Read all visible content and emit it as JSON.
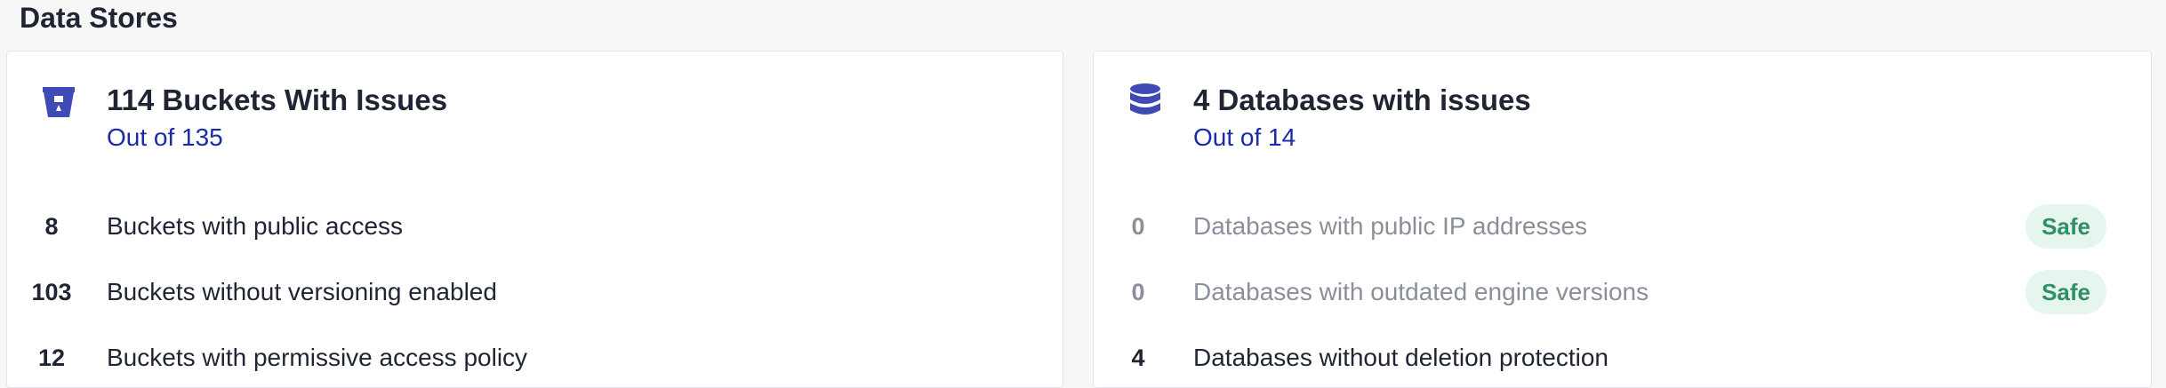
{
  "section": {
    "title": "Data Stores"
  },
  "buckets_card": {
    "icon": "bucket-icon",
    "title": "114 Buckets With Issues",
    "subtitle": "Out of 135",
    "rows": [
      {
        "count": "8",
        "label": "Buckets with public access"
      },
      {
        "count": "103",
        "label": "Buckets without versioning enabled"
      },
      {
        "count": "12",
        "label": "Buckets with permissive access policy"
      }
    ]
  },
  "databases_card": {
    "icon": "database-icon",
    "title": "4 Databases with issues",
    "subtitle": "Out of 14",
    "rows": [
      {
        "count": "0",
        "label": "Databases with public IP addresses",
        "badge": "Safe"
      },
      {
        "count": "0",
        "label": "Databases with outdated engine versions",
        "badge": "Safe"
      },
      {
        "count": "4",
        "label": "Databases without deletion protection"
      }
    ]
  },
  "colors": {
    "accent": "#1a2aa8",
    "icon": "#3f4bb5",
    "safe_bg": "#e6f5ee",
    "safe_text": "#2f8f67",
    "muted_text": "#8a8f99"
  }
}
